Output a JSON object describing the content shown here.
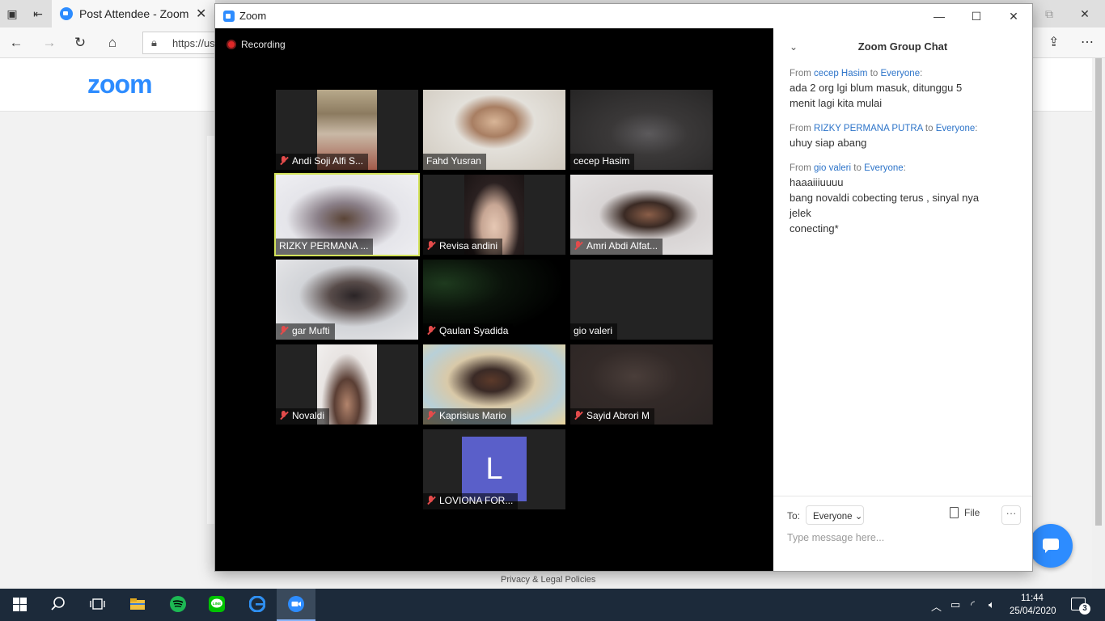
{
  "browser": {
    "tab_title": "Post Attendee - Zoom",
    "tab_close": "✕",
    "url": "https://us",
    "nav": {
      "back": "←",
      "forward": "→",
      "refresh": "↻",
      "home": "⌂"
    },
    "page": {
      "logo": "zoom",
      "footer_link": "Privacy & Legal Policies"
    }
  },
  "zoom_window": {
    "title": "Zoom",
    "controls": {
      "minimize": "—",
      "maximize": "☐",
      "close": "✕"
    },
    "recording_label": "Recording",
    "participants": [
      {
        "name": "Andi Soji Alfi S...",
        "muted": true
      },
      {
        "name": "Fahd Yusran",
        "muted": false
      },
      {
        "name": "cecep Hasim",
        "muted": false
      },
      {
        "name": "RIZKY PERMANA ...",
        "muted": false,
        "active_speaker": true
      },
      {
        "name": "Revisa andini",
        "muted": true
      },
      {
        "name": "Amri Abdi Alfat...",
        "muted": true
      },
      {
        "name": "gar Mufti",
        "muted": true
      },
      {
        "name": "Qaulan Syadida",
        "muted": true
      },
      {
        "name": "gio valeri",
        "muted": false
      },
      {
        "name": "Novaldi",
        "muted": true
      },
      {
        "name": "Kaprisius Mario",
        "muted": true
      },
      {
        "name": "Sayid Abrori M",
        "muted": true
      },
      {
        "name": "LOVIONA FOR...",
        "muted": true,
        "avatar_letter": "L"
      }
    ],
    "chat": {
      "title": "Zoom Group Chat",
      "from_word": "From",
      "to_word": "to",
      "messages": [
        {
          "from": "cecep Hasim",
          "to": "Everyone",
          "lines": [
            "ada 2 org lgi blum masuk, ditunggu 5",
            "menit lagi kita mulai"
          ]
        },
        {
          "from": "RIZKY PERMANA PUTRA",
          "to": "Everyone",
          "lines": [
            "uhuy siap abang"
          ]
        },
        {
          "from": "gio valeri",
          "to": "Everyone",
          "lines": [
            "haaaiiiuuuu",
            "bang novaldi cobecting terus , sinyal nya",
            "jelek",
            "conecting*"
          ]
        }
      ],
      "to_label": "To:",
      "recipient": "Everyone",
      "file_label": "File",
      "more_label": "···",
      "input_placeholder": "Type message here..."
    }
  },
  "taskbar": {
    "time": "11:44",
    "date": "25/04/2020",
    "notification_count": "3"
  }
}
